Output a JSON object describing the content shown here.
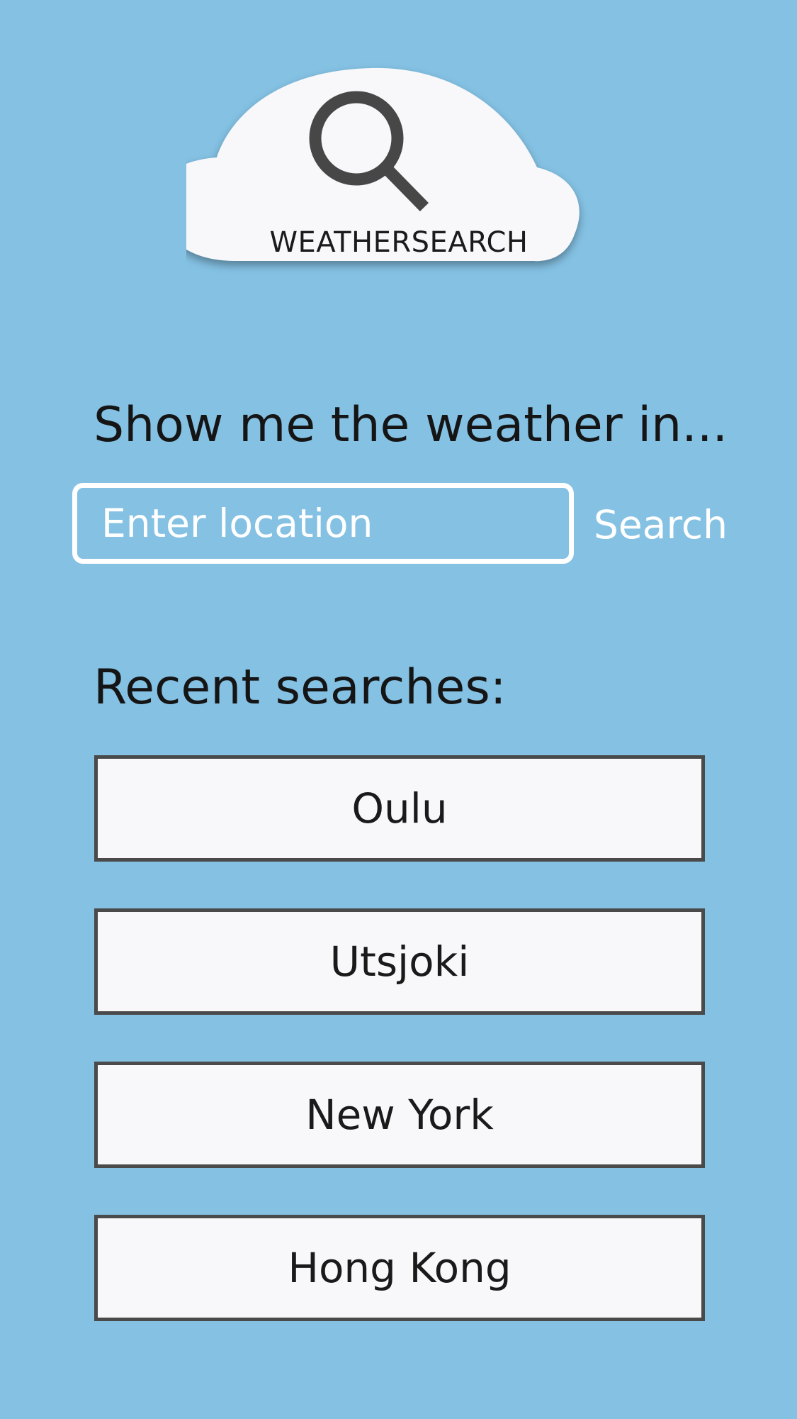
{
  "app": {
    "name": "WEATHERSEARCH"
  },
  "logo": {
    "icon": "search-icon",
    "cloud_color": "#f8f8fa",
    "icon_color": "#474747"
  },
  "search": {
    "prompt": "Show me the weather in...",
    "placeholder": "Enter location",
    "value": "",
    "button_label": "Search"
  },
  "recent": {
    "heading": "Recent searches:",
    "items": [
      {
        "label": "Oulu"
      },
      {
        "label": "Utsjoki"
      },
      {
        "label": "New York"
      },
      {
        "label": "Hong Kong"
      }
    ]
  },
  "colors": {
    "background": "#84c1e3",
    "text": "#151515",
    "button_fill": "#f8f8fa",
    "button_border": "#4a4a4a",
    "input_text": "#ffffff"
  }
}
